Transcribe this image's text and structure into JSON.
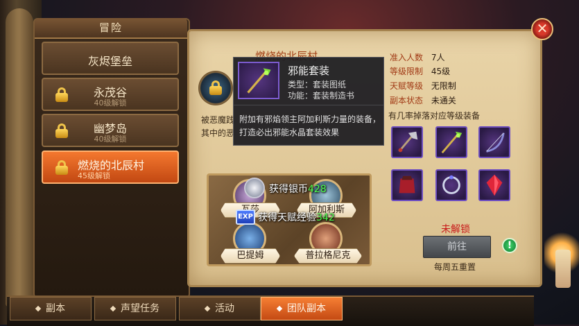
{
  "left_panel": {
    "title": "冒险",
    "stages": [
      {
        "name": "灰烬堡垒",
        "sub": "",
        "locked": false,
        "active": false
      },
      {
        "name": "永茂谷",
        "sub": "40级解锁",
        "locked": true,
        "active": false
      },
      {
        "name": "幽梦岛",
        "sub": "40级解锁",
        "locked": true,
        "active": false
      },
      {
        "name": "燃烧的北辰村",
        "sub": "45级解锁",
        "locked": true,
        "active": true
      }
    ]
  },
  "stage_detail": {
    "title": "燃烧的北辰村",
    "desc_line1": "被恶魔践",
    "desc_line2": "其中的恶",
    "info": [
      {
        "label": "准入人数",
        "value": "7人"
      },
      {
        "label": "等级限制",
        "value": "45级"
      },
      {
        "label": "天赋等级",
        "value": "无限制"
      },
      {
        "label": "副本状态",
        "value": "未通关"
      }
    ],
    "drop_title": "有几率掉落对应等级装备",
    "drops": [
      "axe-icon",
      "staff-icon",
      "bow-icon",
      "armor-icon",
      "ring-icon",
      "gem-icon"
    ],
    "unlock_status": "未解锁",
    "go_label": "前往",
    "reset_text": "每周五重置"
  },
  "rewards": {
    "silver_label": "获得银币",
    "silver_value": "428",
    "exp_label": "获得天赋经验",
    "exp_value": "342",
    "exp_badge": "EXP",
    "bosses": [
      {
        "name": "瓦莎"
      },
      {
        "name": "阿加利斯"
      },
      {
        "name": "巴提姆"
      },
      {
        "name": "普拉格尼克"
      }
    ]
  },
  "tooltip": {
    "name": "邪能套装",
    "type": "类型：套装图纸",
    "function": "功能：套装制造书",
    "description": "附加有邪焰领主阿加利斯力量的装备，打造必出邪能水晶套装效果"
  },
  "tabs": [
    {
      "label": "副本",
      "active": false
    },
    {
      "label": "声望任务",
      "active": false
    },
    {
      "label": "活动",
      "active": false
    },
    {
      "label": "团队副本",
      "active": true
    }
  ],
  "colors": {
    "active_orange": "#e8642a",
    "label_red": "#a13a16",
    "green_value": "#4dff4d",
    "rare_purple": "#6e4fc0"
  }
}
